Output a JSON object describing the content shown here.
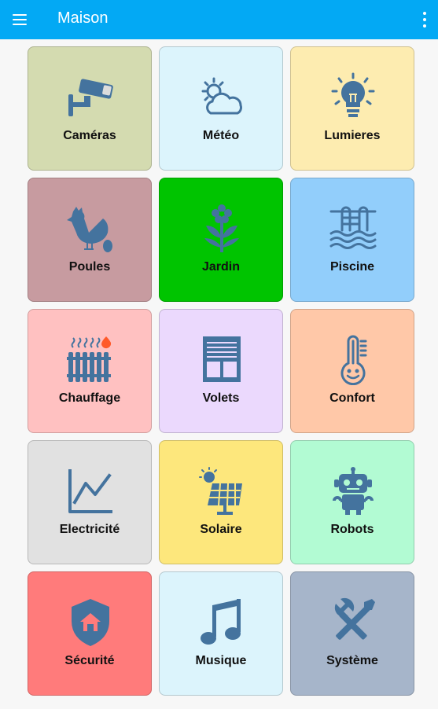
{
  "app": {
    "title": "Maison",
    "menu_icon": "menu-icon",
    "more_icon": "more-vert-icon"
  },
  "accent": "#03a9f4",
  "icon_color": "#44739e",
  "tiles": [
    {
      "label": "Caméras",
      "icon": "cctv-camera-icon",
      "color": "#d4dbb0"
    },
    {
      "label": "Météo",
      "icon": "weather-partly-cloudy-icon",
      "color": "#dcf4fc"
    },
    {
      "label": "Lumieres",
      "icon": "lightbulb-icon",
      "color": "#fdecb0"
    },
    {
      "label": "Poules",
      "icon": "chicken-egg-icon",
      "color": "#c79ba0"
    },
    {
      "label": "Jardin",
      "icon": "flower-icon",
      "color": "#00c400"
    },
    {
      "label": "Piscine",
      "icon": "pool-icon",
      "color": "#92cefb"
    },
    {
      "label": "Chauffage",
      "icon": "radiator-icon",
      "color": "#ffc1c1"
    },
    {
      "label": "Volets",
      "icon": "window-shutter-icon",
      "color": "#ebd9fd"
    },
    {
      "label": "Confort",
      "icon": "thermometer-smile-icon",
      "color": "#ffc8a8"
    },
    {
      "label": "Electricité",
      "icon": "chart-line-icon",
      "color": "#e1e1e1"
    },
    {
      "label": "Solaire",
      "icon": "solar-panel-icon",
      "color": "#fde77c"
    },
    {
      "label": "Robots",
      "icon": "robot-icon",
      "color": "#b2fbd3"
    },
    {
      "label": "Sécurité",
      "icon": "shield-home-icon",
      "color": "#ff7b7b"
    },
    {
      "label": "Musique",
      "icon": "music-note-icon",
      "color": "#dcf4fc"
    },
    {
      "label": "Système",
      "icon": "tools-icon",
      "color": "#a6b5ca"
    }
  ]
}
